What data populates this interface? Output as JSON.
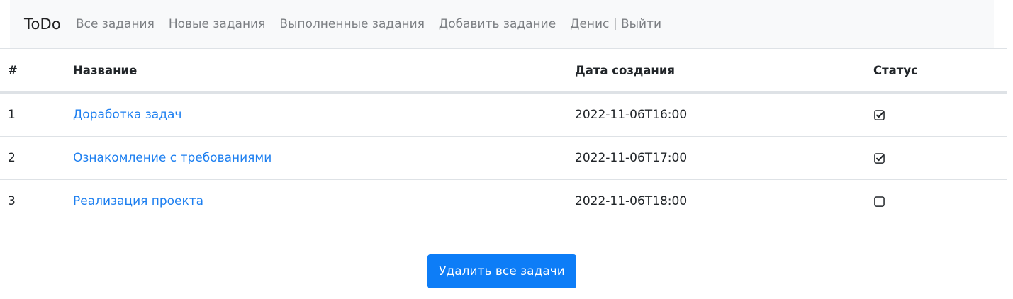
{
  "navbar": {
    "brand": "ToDo",
    "links": [
      {
        "label": "Все задания"
      },
      {
        "label": "Новые задания"
      },
      {
        "label": "Выполненные задания"
      },
      {
        "label": "Добавить задание"
      }
    ],
    "user": "Денис",
    "separator": "|",
    "logout": "Выйти"
  },
  "table": {
    "headers": {
      "num": "#",
      "title": "Название",
      "created": "Дата создания",
      "status": "Статус"
    },
    "rows": [
      {
        "num": "1",
        "title": "Доработка задач",
        "created": "2022-11-06T16:00",
        "done": true
      },
      {
        "num": "2",
        "title": "Ознакомление с требованиями",
        "created": "2022-11-06T17:00",
        "done": true
      },
      {
        "num": "3",
        "title": "Реализация проекта",
        "created": "2022-11-06T18:00",
        "done": false
      }
    ]
  },
  "actions": {
    "delete_all_label": "Удалить все задачи"
  },
  "colors": {
    "navbar_bg": "#f8f9fa",
    "link": "#1d7ff0",
    "button": "#0d7df7",
    "nav_text": "#7c7f83"
  }
}
